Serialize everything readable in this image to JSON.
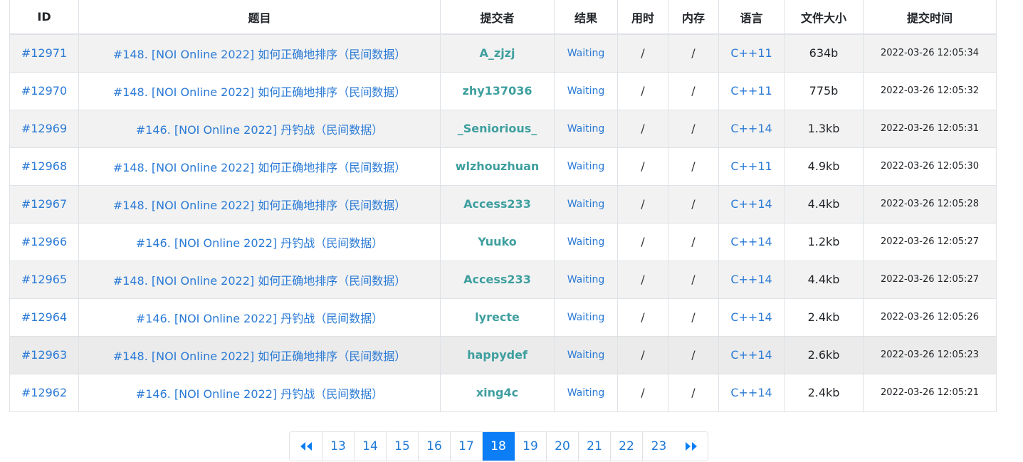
{
  "table": {
    "headers": [
      "ID",
      "题目",
      "提交者",
      "结果",
      "用时",
      "内存",
      "语言",
      "文件大小",
      "提交时间"
    ],
    "rows": [
      {
        "id": "#12971",
        "problem": "#148. [NOI Online 2022] 如何正确地排序（民间数据）",
        "submitter": "A_zjzj",
        "result": "Waiting",
        "time_used": "/",
        "memory": "/",
        "language": "C++11",
        "size": "634b",
        "submitted": "2022-03-26 12:05:34"
      },
      {
        "id": "#12970",
        "problem": "#148. [NOI Online 2022] 如何正确地排序（民间数据）",
        "submitter": "zhy137036",
        "result": "Waiting",
        "time_used": "/",
        "memory": "/",
        "language": "C++11",
        "size": "775b",
        "submitted": "2022-03-26 12:05:32"
      },
      {
        "id": "#12969",
        "problem": "#146. [NOI Online 2022] 丹钓战（民间数据）",
        "submitter": "_Seniorious_",
        "result": "Waiting",
        "time_used": "/",
        "memory": "/",
        "language": "C++14",
        "size": "1.3kb",
        "submitted": "2022-03-26 12:05:31"
      },
      {
        "id": "#12968",
        "problem": "#148. [NOI Online 2022] 如何正确地排序（民间数据）",
        "submitter": "wlzhouzhuan",
        "result": "Waiting",
        "time_used": "/",
        "memory": "/",
        "language": "C++11",
        "size": "4.9kb",
        "submitted": "2022-03-26 12:05:30"
      },
      {
        "id": "#12967",
        "problem": "#148. [NOI Online 2022] 如何正确地排序（民间数据）",
        "submitter": "Access233",
        "result": "Waiting",
        "time_used": "/",
        "memory": "/",
        "language": "C++14",
        "size": "4.4kb",
        "submitted": "2022-03-26 12:05:28"
      },
      {
        "id": "#12966",
        "problem": "#146. [NOI Online 2022] 丹钓战（民间数据）",
        "submitter": "Yuuko",
        "result": "Waiting",
        "time_used": "/",
        "memory": "/",
        "language": "C++14",
        "size": "1.2kb",
        "submitted": "2022-03-26 12:05:27"
      },
      {
        "id": "#12965",
        "problem": "#148. [NOI Online 2022] 如何正确地排序（民间数据）",
        "submitter": "Access233",
        "result": "Waiting",
        "time_used": "/",
        "memory": "/",
        "language": "C++14",
        "size": "4.4kb",
        "submitted": "2022-03-26 12:05:27"
      },
      {
        "id": "#12964",
        "problem": "#146. [NOI Online 2022] 丹钓战（民间数据）",
        "submitter": "lyrecte",
        "result": "Waiting",
        "time_used": "/",
        "memory": "/",
        "language": "C++14",
        "size": "2.4kb",
        "submitted": "2022-03-26 12:05:26"
      },
      {
        "id": "#12963",
        "problem": "#148. [NOI Online 2022] 如何正确地排序（民间数据）",
        "submitter": "happydef",
        "result": "Waiting",
        "time_used": "/",
        "memory": "/",
        "language": "C++14",
        "size": "2.6kb",
        "submitted": "2022-03-26 12:05:23"
      },
      {
        "id": "#12962",
        "problem": "#146. [NOI Online 2022] 丹钓战（民间数据）",
        "submitter": "xing4c",
        "result": "Waiting",
        "time_used": "/",
        "memory": "/",
        "language": "C++14",
        "size": "2.4kb",
        "submitted": "2022-03-26 12:05:21"
      }
    ]
  },
  "pagination": {
    "pages": [
      "13",
      "14",
      "15",
      "16",
      "17",
      "18",
      "19",
      "20",
      "21",
      "22",
      "23"
    ],
    "active": "18",
    "first_icon": "double-chevron-left-icon",
    "last_icon": "double-chevron-right-icon"
  },
  "colors": {
    "link": "#2a7ad6",
    "submitter": "#3f9f9f",
    "active_page": "#0b7ef5"
  }
}
